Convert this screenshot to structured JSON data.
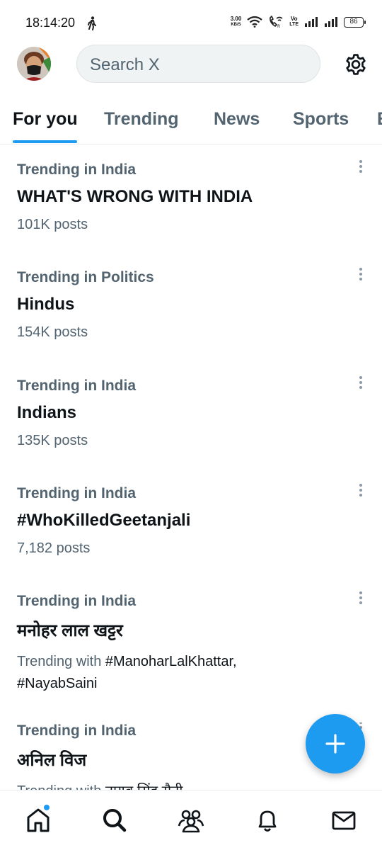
{
  "status_bar": {
    "time": "18:14:20",
    "net_speed_value": "3.00",
    "net_speed_unit": "KB/S",
    "volte_top": "Vo",
    "volte_bottom": "LTE",
    "battery": "86"
  },
  "header": {
    "search_placeholder": "Search X"
  },
  "tabs": [
    {
      "label": "For you",
      "active": true
    },
    {
      "label": "Trending",
      "active": false
    },
    {
      "label": "News",
      "active": false
    },
    {
      "label": "Sports",
      "active": false
    },
    {
      "label": "E",
      "active": false
    }
  ],
  "trends": [
    {
      "category": "Trending in India",
      "title": "WHAT'S WRONG WITH INDIA",
      "meta": "101K posts"
    },
    {
      "category": "Trending in Politics",
      "title": "Hindus",
      "meta": "154K posts"
    },
    {
      "category": "Trending in India",
      "title": "Indians",
      "meta": "135K posts"
    },
    {
      "category": "Trending in India",
      "title": "#WhoKilledGeetanjali",
      "meta": "7,182 posts"
    },
    {
      "category": "Trending in India",
      "title": "मनोहर लाल खट्टर",
      "with_prefix": "Trending with",
      "with_tags": "#ManoharLalKhattar, #NayabSaini"
    },
    {
      "category": "Trending in India",
      "title": "अनिल विज",
      "with_prefix": "Trending with",
      "with_tags": "नायब सिंह सैनी"
    }
  ],
  "colors": {
    "accent": "#1d9bf0",
    "text_primary": "#0f1419",
    "text_secondary": "#536471"
  },
  "icons": {
    "settings": "gear-icon",
    "more": "more-vertical-icon",
    "compose": "plus-icon",
    "nav": [
      "home-icon",
      "search-icon",
      "communities-icon",
      "bell-icon",
      "mail-icon"
    ]
  }
}
